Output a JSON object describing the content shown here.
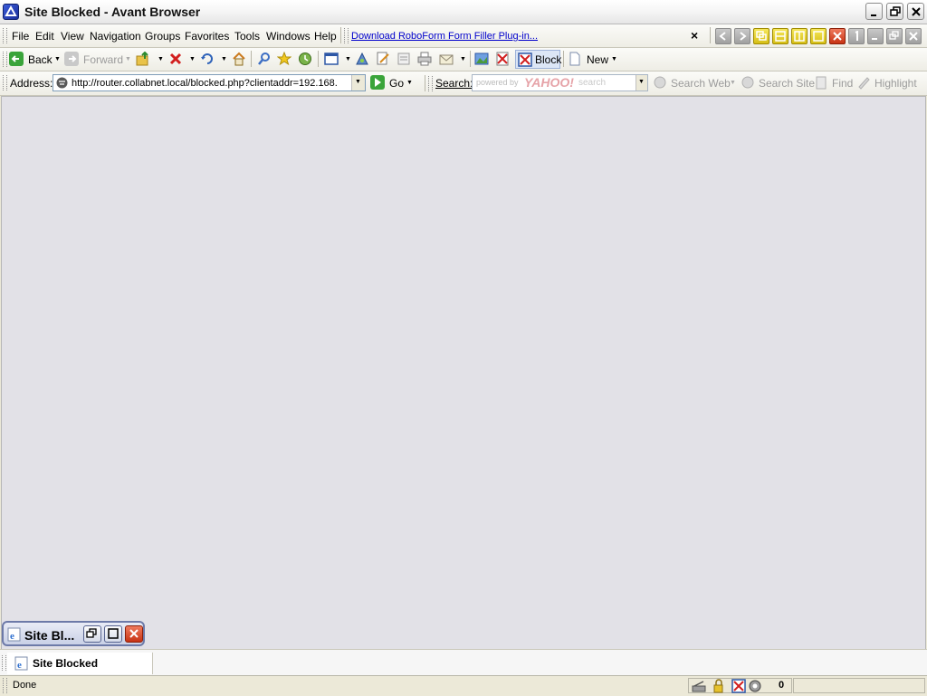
{
  "window": {
    "title": "Site Blocked - Avant Browser"
  },
  "menu": {
    "items": [
      "File",
      "Edit",
      "View",
      "Navigation",
      "Groups",
      "Favorites",
      "Tools",
      "Windows",
      "Help"
    ],
    "download_link": "Download RoboForm Form Filler Plug-in...",
    "close_symbol": "×"
  },
  "toolbar": {
    "back": "Back",
    "forward": "Forward",
    "block": "Block",
    "new": "New"
  },
  "address": {
    "label": "Address:",
    "url": "http://router.collabnet.local/blocked.php?clientaddr=192.168.",
    "go": "Go"
  },
  "search": {
    "label": "Search:",
    "powered_by": "powered by",
    "brand": "YAHOO!",
    "brand_suffix": "search",
    "search_web": "Search Web",
    "search_site": "Search Site",
    "find": "Find",
    "highlight": "Highlight"
  },
  "minimized_tab": {
    "label": "Site Bl..."
  },
  "tabs": [
    {
      "label": "Site Blocked",
      "active": true
    }
  ],
  "status": {
    "text": "Done",
    "count": "0"
  },
  "colors": {
    "link": "#0000cc",
    "content_bg": "#e2e1e7",
    "accent": "#3a5bd9"
  },
  "icons": [
    "app-logo-icon",
    "back-arrow-icon",
    "forward-arrow-icon",
    "up-folder-icon",
    "stop-icon",
    "refresh-icon",
    "home-icon",
    "search-magnifier-icon",
    "favorites-star-icon",
    "history-icon",
    "window-icon",
    "translate-icon",
    "edit-icon",
    "page-icon",
    "print-icon",
    "mail-icon",
    "image-block-icon",
    "flash-block-icon",
    "block-icon",
    "new-page-icon",
    "go-arrow-icon",
    "ie-page-icon"
  ]
}
